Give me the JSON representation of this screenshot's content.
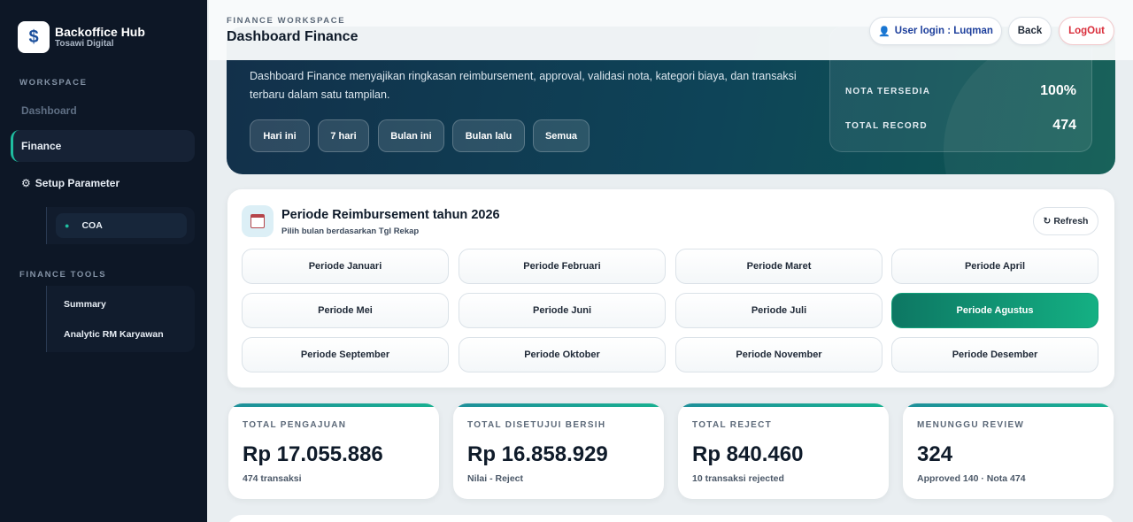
{
  "brand": {
    "logo_glyph": "$",
    "title": "Backoffice Hub",
    "subtitle": "Tosawi Digital"
  },
  "sidebar": {
    "workspace_label": "WORKSPACE",
    "nav": {
      "dashboard": "Dashboard",
      "finance": "Finance",
      "setup": "Setup Parameter"
    },
    "coa": "COA",
    "tools_label": "FINANCE TOOLS",
    "tools": {
      "summary": "Summary",
      "analytic": "Analytic RM Karyawan"
    }
  },
  "header": {
    "workspace_label": "FINANCE WORKSPACE",
    "title": "Dashboard Finance",
    "user_login": "User login : Luqman",
    "back": "Back",
    "logout": "LogOut"
  },
  "hero": {
    "description": "Dashboard Finance menyajikan ringkasan reimbursement, approval, validasi nota, kategori biaya, dan transaksi terbaru dalam satu tampilan.",
    "filters": {
      "today": "Hari ini",
      "seven_days": "7 hari",
      "this_month": "Bulan ini",
      "last_month": "Bulan lalu",
      "all": "Semua"
    },
    "stats": {
      "nota_label": "NOTA TERSEDIA",
      "nota_value": "100%",
      "record_label": "TOTAL RECORD",
      "record_value": "474"
    }
  },
  "periode": {
    "title": "Periode Reimbursement tahun 2026",
    "subtitle": "Pilih bulan berdasarkan Tgl Rekap",
    "refresh": "Refresh",
    "selected": "Periode Agustus",
    "months": {
      "jan": "Periode Januari",
      "feb": "Periode Februari",
      "mar": "Periode Maret",
      "apr": "Periode April",
      "may": "Periode Mei",
      "jun": "Periode Juni",
      "jul": "Periode Juli",
      "aug": "Periode Agustus",
      "sep": "Periode September",
      "oct": "Periode Oktober",
      "nov": "Periode November",
      "dec": "Periode Desember"
    }
  },
  "summary": {
    "total_pengajuan": {
      "label": "TOTAL PENGAJUAN",
      "value": "Rp 17.055.886",
      "note": "474 transaksi"
    },
    "total_disetujui": {
      "label": "TOTAL DISETUJUI BERSIH",
      "value": "Rp 16.858.929",
      "note": "Nilai - Reject"
    },
    "total_reject": {
      "label": "TOTAL REJECT",
      "value": "Rp 840.460",
      "note": "10 transaksi rejected"
    },
    "menunggu_review": {
      "label": "MENUNGGU REVIEW",
      "value": "324",
      "note": "Approved 140 · Nota 474"
    }
  },
  "colors": {
    "accent": "#14b083",
    "sidebar_bg": "#0d1726",
    "logout": "#d92d3a",
    "link": "#1d3f9c"
  },
  "icons": {
    "settings": "gear-icon",
    "user": "user-icon",
    "calendar": "calendar-icon",
    "refresh": "refresh-icon"
  }
}
